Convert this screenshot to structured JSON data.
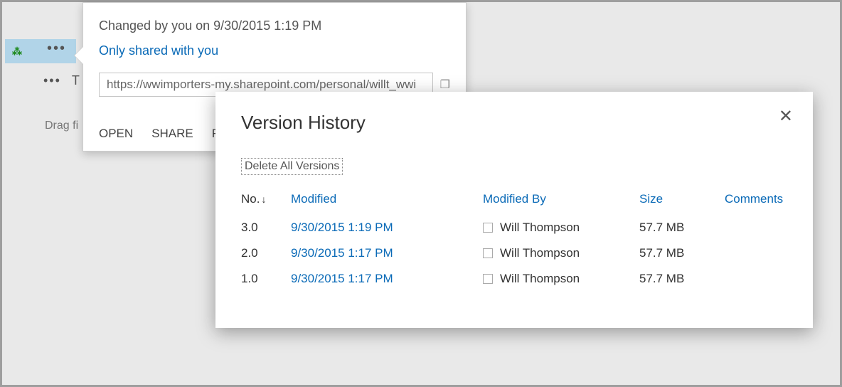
{
  "background": {
    "drag_text": "Drag fi",
    "row2_letter": "T"
  },
  "callout": {
    "changed_by": "Changed by you on 9/30/2015 1:19 PM",
    "shared_with": "Only shared with you",
    "url": "https://wwimporters-my.sharepoint.com/personal/willt_wwi",
    "actions": {
      "open": "OPEN",
      "share": "SHARE",
      "follow_partial": "F"
    }
  },
  "modal": {
    "title": "Version History",
    "delete_all": "Delete All Versions",
    "columns": {
      "no": "No.",
      "modified": "Modified",
      "modified_by": "Modified By",
      "size": "Size",
      "comments": "Comments"
    },
    "rows": [
      {
        "no": "3.0",
        "modified": "9/30/2015 1:19 PM",
        "modified_by": "Will Thompson",
        "size": "57.7 MB",
        "comments": ""
      },
      {
        "no": "2.0",
        "modified": "9/30/2015 1:17 PM",
        "modified_by": "Will Thompson",
        "size": "57.7 MB",
        "comments": ""
      },
      {
        "no": "1.0",
        "modified": "9/30/2015 1:17 PM",
        "modified_by": "Will Thompson",
        "size": "57.7 MB",
        "comments": ""
      }
    ]
  }
}
